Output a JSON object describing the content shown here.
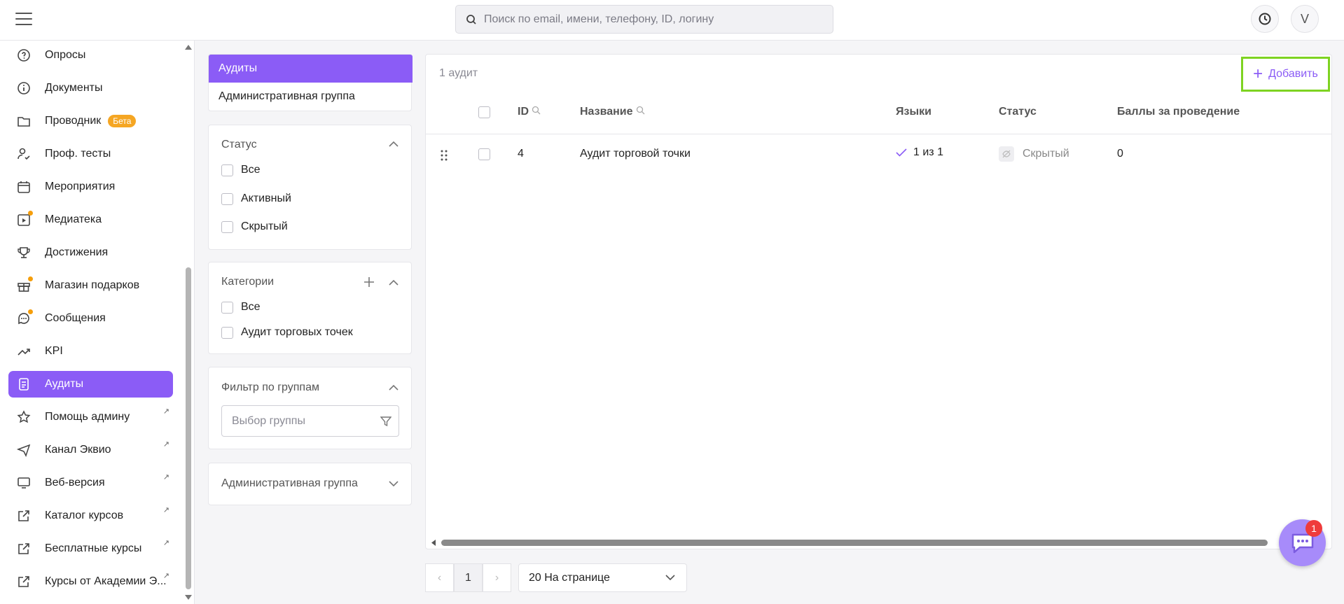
{
  "search": {
    "placeholder": "Поиск по email, имени, телефону, ID, логину"
  },
  "header": {
    "avatar_letter": "V"
  },
  "sidebar": {
    "items": [
      {
        "label": "Опросы",
        "icon": "survey-icon"
      },
      {
        "label": "Документы",
        "icon": "info-icon"
      },
      {
        "label": "Проводник",
        "icon": "folder-icon",
        "badge": "Бета"
      },
      {
        "label": "Проф. тесты",
        "icon": "user-check-icon"
      },
      {
        "label": "Мероприятия",
        "icon": "calendar-icon"
      },
      {
        "label": "Медиатека",
        "icon": "media-icon"
      },
      {
        "label": "Достижения",
        "icon": "trophy-icon"
      },
      {
        "label": "Магазин подарков",
        "icon": "gift-icon"
      },
      {
        "label": "Сообщения",
        "icon": "chat-icon"
      },
      {
        "label": "KPI",
        "icon": "trend-icon"
      },
      {
        "label": "Аудиты",
        "icon": "document-icon",
        "active": true
      },
      {
        "label": "Помощь админу",
        "icon": "star-icon"
      },
      {
        "label": "Канал Эквио",
        "icon": "send-icon"
      },
      {
        "label": "Веб-версия",
        "icon": "monitor-icon"
      },
      {
        "label": "Каталог курсов",
        "icon": "external-link-icon"
      },
      {
        "label": "Бесплатные курсы",
        "icon": "external-link-icon"
      },
      {
        "label": "Курсы от Академии Э...",
        "icon": "external-link-icon"
      }
    ]
  },
  "filters": {
    "tabs": [
      "Аудиты",
      "Административная группа"
    ],
    "status": {
      "title": "Статус",
      "options": [
        "Все",
        "Активный",
        "Скрытый"
      ]
    },
    "categories": {
      "title": "Категории",
      "options": [
        "Все",
        "Аудит торговых точек"
      ]
    },
    "group_filter": {
      "title": "Фильтр по группам",
      "placeholder": "Выбор группы"
    },
    "admin_group": {
      "title": "Административная группа"
    }
  },
  "table": {
    "count_label": "1 аудит",
    "add_label": "Добавить",
    "columns": [
      "ID",
      "Название",
      "Языки",
      "Статус",
      "Баллы за проведение"
    ],
    "rows": [
      {
        "id": "4",
        "name": "Аудит торговой точки",
        "languages": "1 из 1",
        "status": "Скрытый",
        "points": "0"
      }
    ]
  },
  "pagination": {
    "current_page": "1",
    "per_page": "20 На странице"
  },
  "chat": {
    "unread": "1"
  },
  "colors": {
    "accent": "#8b5cf6",
    "highlight": "#7ed321",
    "badge": "#f5a623"
  }
}
